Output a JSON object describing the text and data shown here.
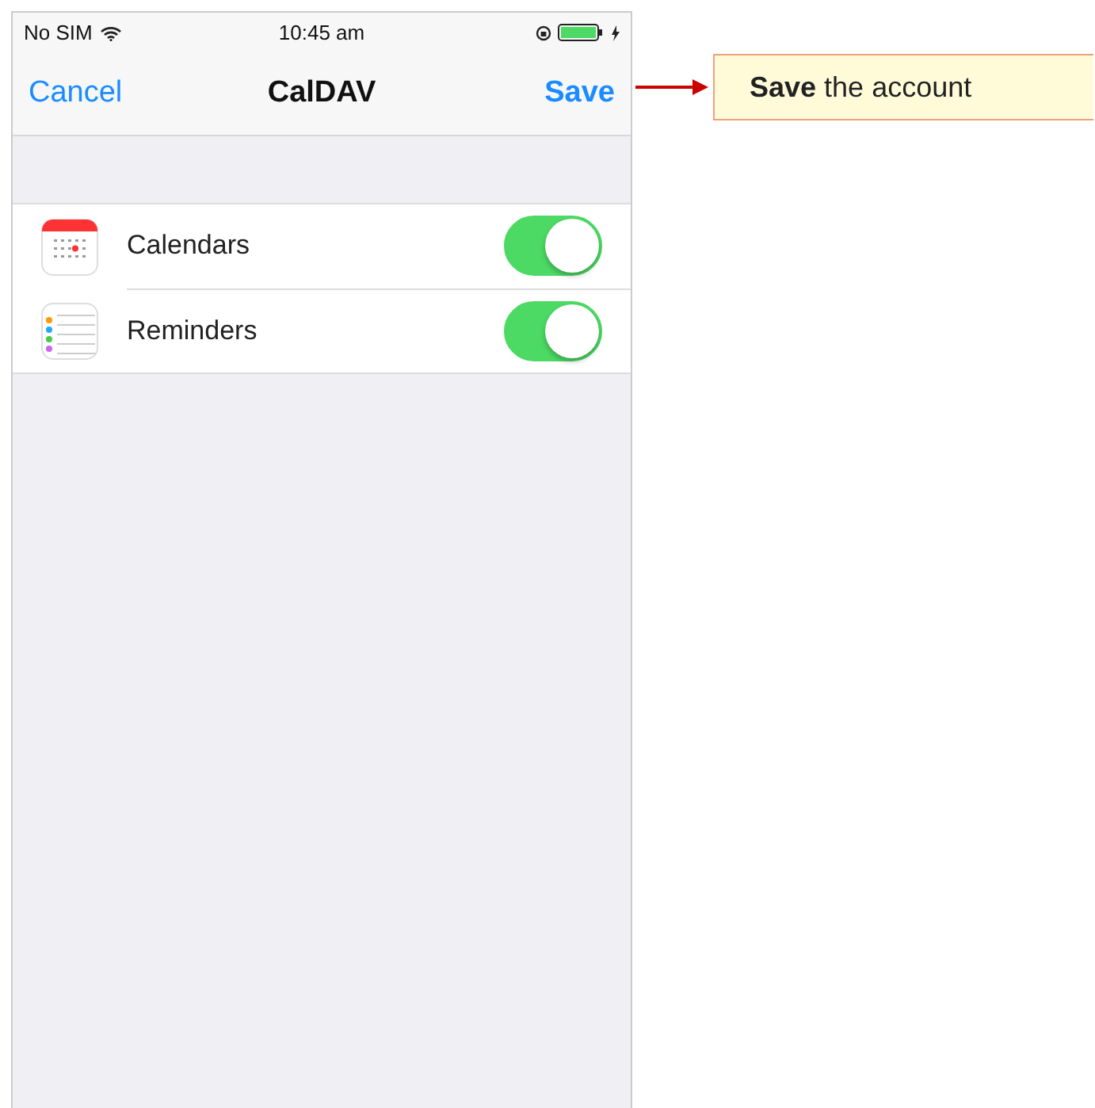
{
  "status_bar": {
    "carrier": "No SIM",
    "time": "10:45 am"
  },
  "nav": {
    "left": "Cancel",
    "title": "CalDAV",
    "right": "Save"
  },
  "settings": [
    {
      "kind": "calendar",
      "label": "Calendars",
      "on": true
    },
    {
      "kind": "reminders",
      "label": "Reminders",
      "on": true
    }
  ],
  "callout": {
    "text": "**Save** the account"
  }
}
